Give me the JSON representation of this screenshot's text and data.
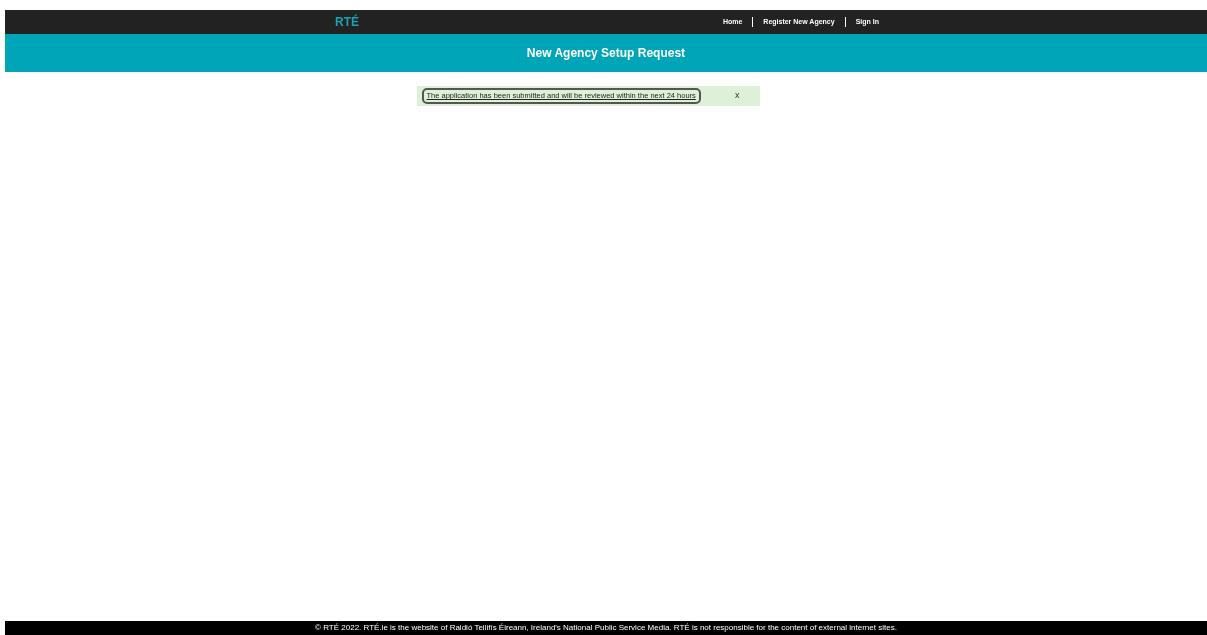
{
  "header": {
    "logo": "RTÉ",
    "nav": [
      {
        "label": "Home"
      },
      {
        "label": "Register New Agency"
      },
      {
        "label": "Sign In"
      }
    ]
  },
  "banner": {
    "title": "New Agency Setup Request"
  },
  "alert": {
    "message": "The application has been submitted and will be reviewed within the next 24 hours",
    "close": "x"
  },
  "footer": {
    "text": "© RTÉ 2022. RTÉ.ie is the website of Raidió Teilifís Éireann, Ireland's National Public Service Media. RTÉ is not responsible for the content of external internet sites."
  }
}
